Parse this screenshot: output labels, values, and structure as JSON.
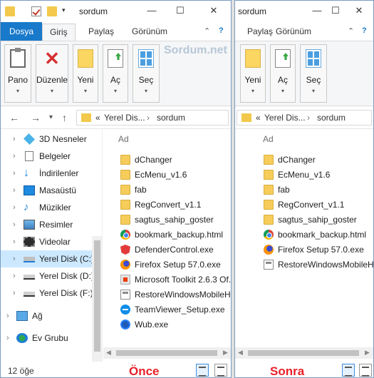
{
  "left_window": {
    "title": "sordum",
    "ribbon_tabs": [
      "Dosya",
      "Giriş",
      "Paylaş",
      "Görünüm"
    ],
    "ribbon_buttons": [
      {
        "label": "Pano",
        "icon": "clipboard-icon"
      },
      {
        "label": "Düzenle",
        "icon": "delete-x-icon"
      },
      {
        "label": "Yeni",
        "icon": "new-folder-icon"
      },
      {
        "label": "Aç",
        "icon": "open-icon"
      },
      {
        "label": "Seç",
        "icon": "select-grid-icon"
      }
    ],
    "watermark": "Sordum.net",
    "address": {
      "overflow": "«",
      "segments": [
        "Yerel Dis...",
        "sordum"
      ]
    },
    "nav_items": [
      {
        "label": "3D Nesneler",
        "icon": "3d-objects-icon"
      },
      {
        "label": "Belgeler",
        "icon": "documents-icon"
      },
      {
        "label": "İndirilenler",
        "icon": "downloads-icon"
      },
      {
        "label": "Masaüstü",
        "icon": "desktop-icon"
      },
      {
        "label": "Müzikler",
        "icon": "music-icon"
      },
      {
        "label": "Resimler",
        "icon": "pictures-icon"
      },
      {
        "label": "Videolar",
        "icon": "videos-icon"
      },
      {
        "label": "Yerel Disk (C:)",
        "icon": "local-disk-icon",
        "selected": true
      },
      {
        "label": "Yerel Disk (D:)",
        "icon": "drive-icon"
      },
      {
        "label": "Yerel Disk (F:)",
        "icon": "drive-icon"
      },
      {
        "label": "Ağ",
        "icon": "network-icon"
      },
      {
        "label": "Ev Grubu",
        "icon": "homegroup-icon"
      }
    ],
    "column_header": "Ad",
    "files": [
      {
        "name": "dChanger",
        "icon": "folder"
      },
      {
        "name": "EcMenu_v1.6",
        "icon": "folder"
      },
      {
        "name": "fab",
        "icon": "folder"
      },
      {
        "name": "RegConvert_v1.1",
        "icon": "folder"
      },
      {
        "name": "sagtus_sahip_goster",
        "icon": "folder"
      },
      {
        "name": "bookmark_backup.html",
        "icon": "chrome"
      },
      {
        "name": "DefenderControl.exe",
        "icon": "shield"
      },
      {
        "name": "Firefox Setup 57.0.exe",
        "icon": "firefox"
      },
      {
        "name": "Microsoft Toolkit 2.6.3 Of...",
        "icon": "office"
      },
      {
        "name": "RestoreWindowsMobileH...",
        "icon": "app"
      },
      {
        "name": "TeamViewer_Setup.exe",
        "icon": "teamviewer"
      },
      {
        "name": "Wub.exe",
        "icon": "wub"
      }
    ],
    "status_count": "12 öğe",
    "caption": "Önce"
  },
  "right_window": {
    "title": "sordum",
    "ribbon_tabs": [
      "Paylaş",
      "Görünüm"
    ],
    "ribbon_buttons": [
      {
        "label": "Yeni",
        "icon": "new-folder-icon"
      },
      {
        "label": "Aç",
        "icon": "open-icon"
      },
      {
        "label": "Seç",
        "icon": "select-grid-icon"
      }
    ],
    "address": {
      "overflow": "«",
      "segments": [
        "Yerel Dis...",
        "sordum"
      ]
    },
    "column_header": "Ad",
    "files": [
      {
        "name": "dChanger",
        "icon": "folder"
      },
      {
        "name": "EcMenu_v1.6",
        "icon": "folder"
      },
      {
        "name": "fab",
        "icon": "folder"
      },
      {
        "name": "RegConvert_v1.1",
        "icon": "folder"
      },
      {
        "name": "sagtus_sahip_goster",
        "icon": "folder"
      },
      {
        "name": "bookmark_backup.html",
        "icon": "chrome"
      },
      {
        "name": "Firefox Setup 57.0.exe",
        "icon": "firefox"
      },
      {
        "name": "RestoreWindowsMobileH",
        "icon": "app"
      }
    ],
    "caption": "Sonra"
  },
  "window_controls": {
    "minimize": "—",
    "maximize": "☐",
    "close": "✕",
    "help": "?",
    "collapse": "⌃"
  }
}
